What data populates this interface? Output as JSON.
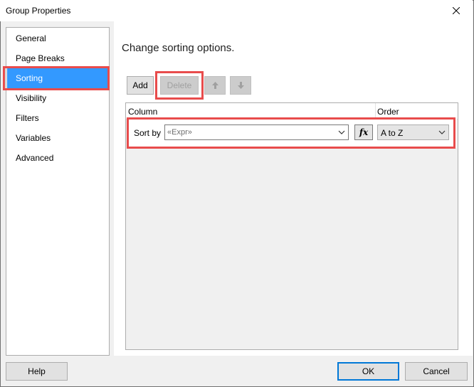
{
  "window": {
    "title": "Group Properties",
    "close_icon": "close-icon"
  },
  "nav": {
    "items": [
      {
        "label": "General"
      },
      {
        "label": "Page Breaks"
      },
      {
        "label": "Sorting",
        "selected": true
      },
      {
        "label": "Visibility"
      },
      {
        "label": "Filters"
      },
      {
        "label": "Variables"
      },
      {
        "label": "Advanced"
      }
    ]
  },
  "main": {
    "heading": "Change sorting options.",
    "toolbar": {
      "add_label": "Add",
      "delete_label": "Delete",
      "move_up_icon": "arrow-up-icon",
      "move_down_icon": "arrow-down-icon"
    },
    "grid": {
      "columns": [
        "Column",
        "Order"
      ],
      "rows": [
        {
          "label": "Sort by",
          "expression": "«Expr»",
          "fx_label": "fx",
          "order": "A to Z"
        }
      ]
    }
  },
  "footer": {
    "help_label": "Help",
    "ok_label": "OK",
    "cancel_label": "Cancel"
  },
  "colors": {
    "selection": "#3399ff",
    "highlight": "#e84c4c",
    "default_button_border": "#0078d7"
  }
}
